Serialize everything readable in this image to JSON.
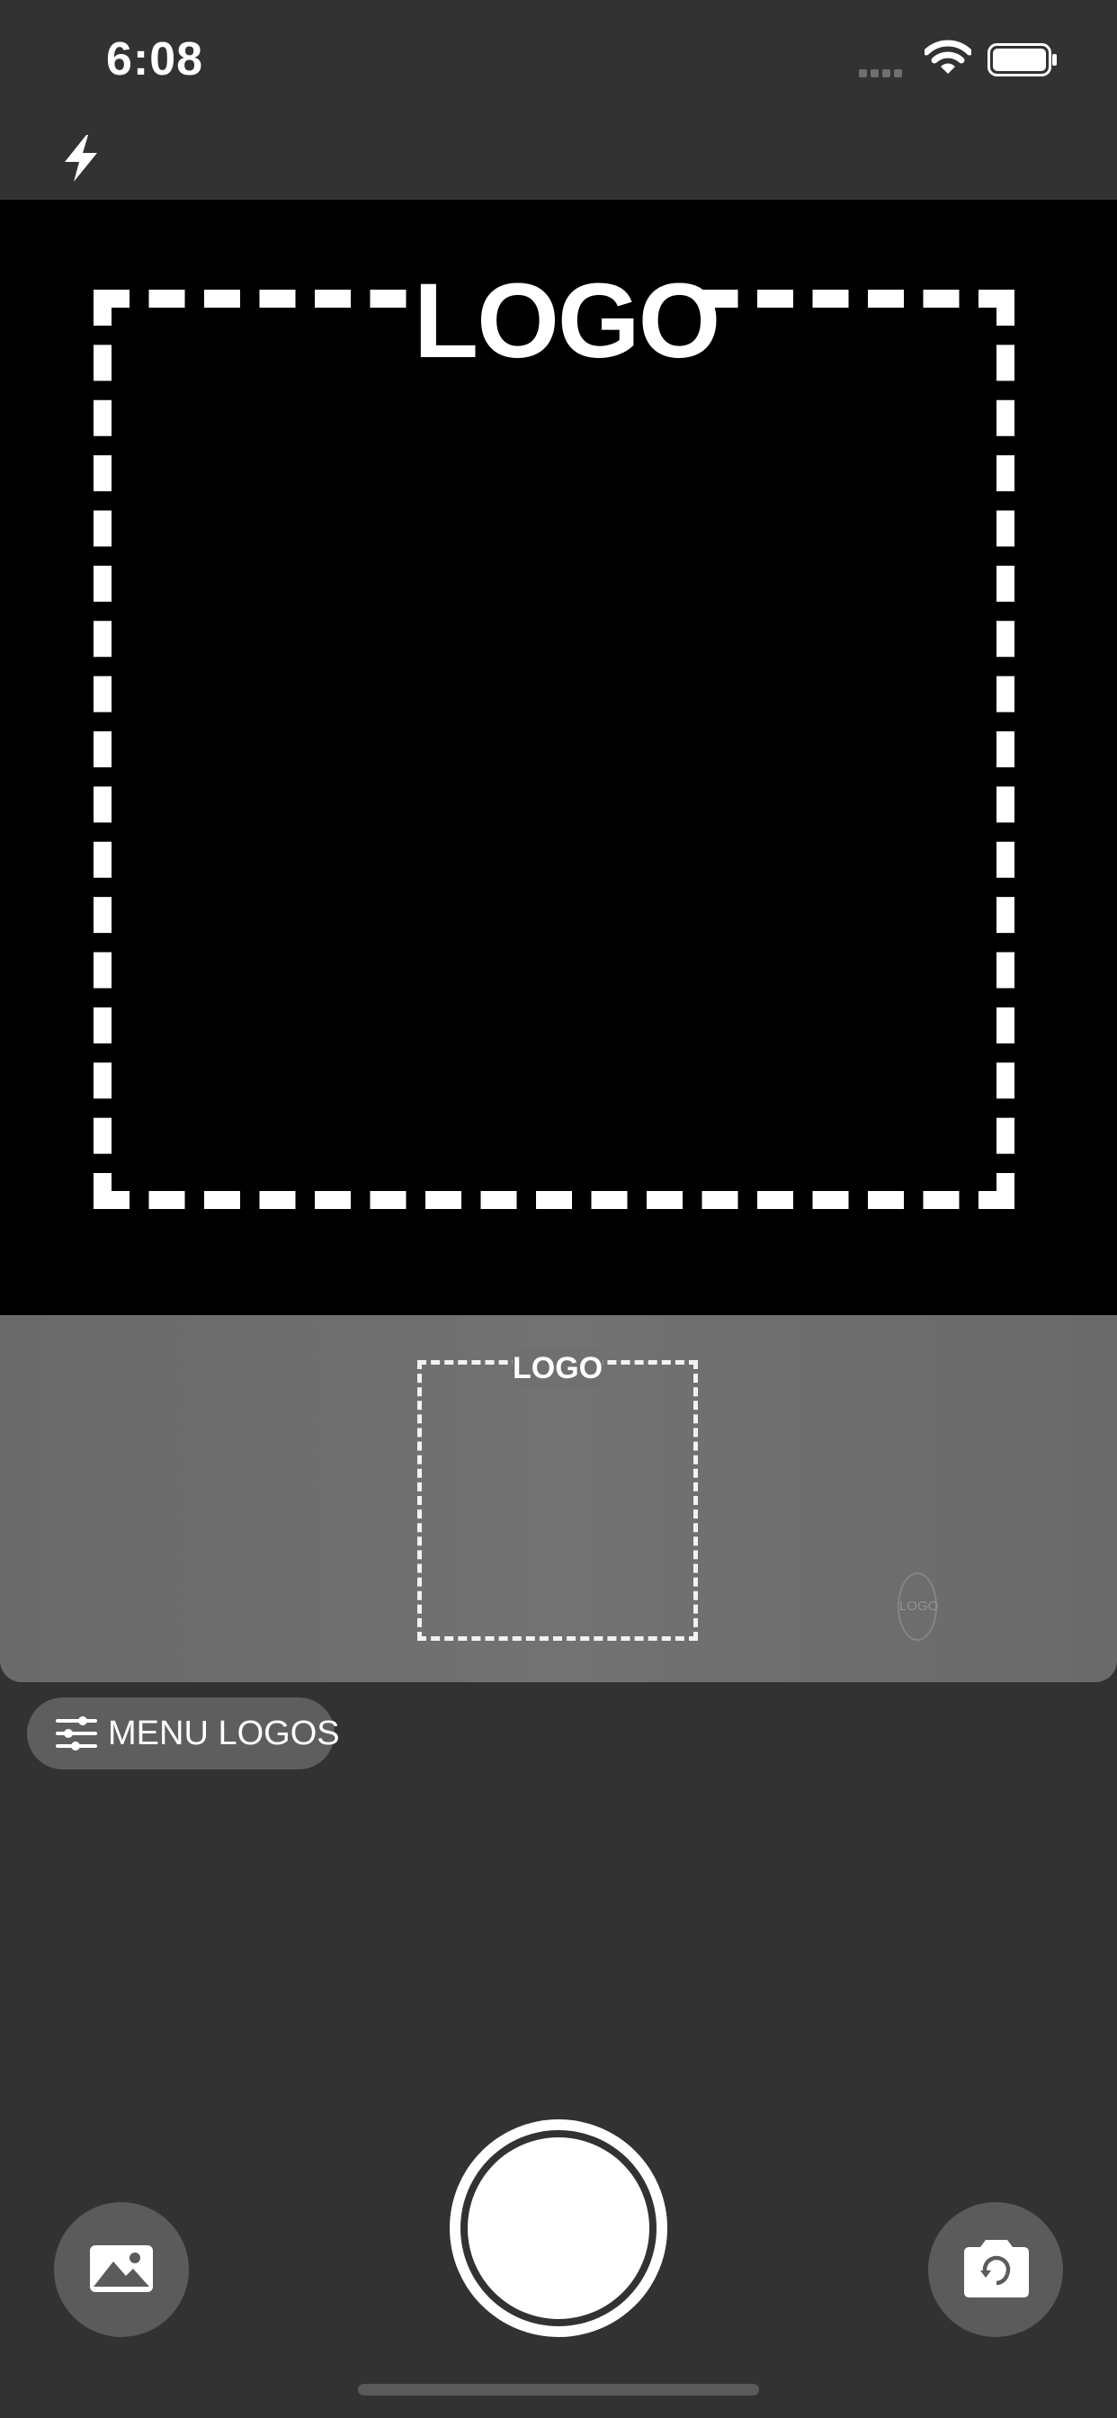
{
  "status_bar": {
    "time": "6:08"
  },
  "toolbar": {
    "flash_icon": "flash-icon"
  },
  "viewport": {
    "overlay_label": "LOGO"
  },
  "templates": {
    "selected_label": "LOGO",
    "second_label": "LOGO"
  },
  "menu": {
    "label": "MENU LOGOS",
    "icon": "sliders-icon"
  },
  "controls": {
    "gallery_icon": "gallery-icon",
    "shutter_icon": "shutter-button",
    "flip_icon": "flip-camera-icon"
  },
  "colors": {
    "background": "#323232",
    "viewport": "#000000",
    "strip": "#6e6e6e",
    "accent": "#ffffff"
  }
}
